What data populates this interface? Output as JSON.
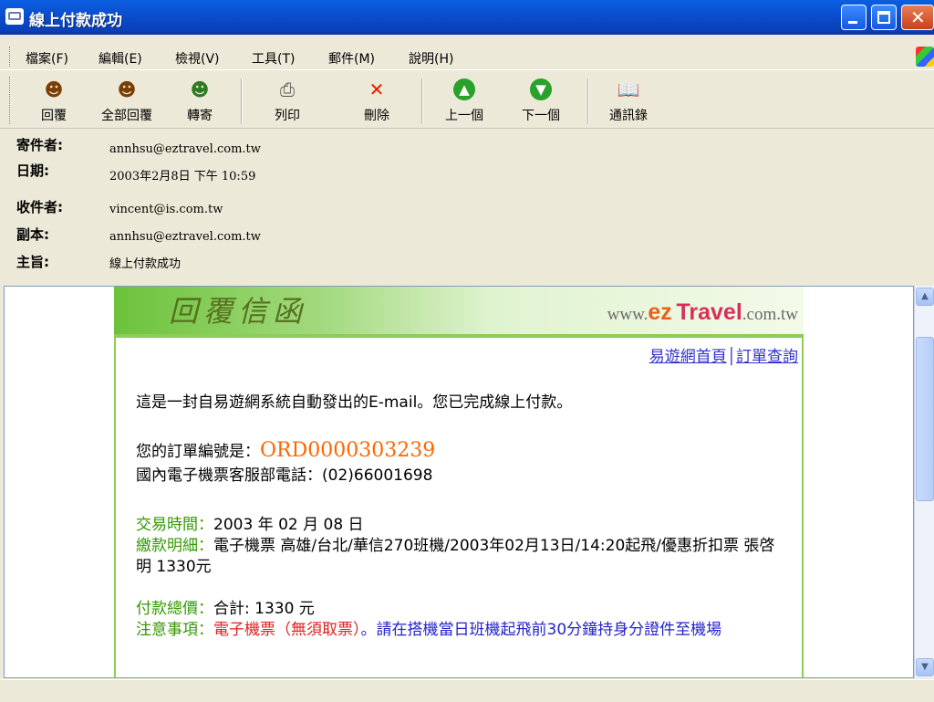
{
  "window": {
    "title": "線上付款成功"
  },
  "menu": [
    "檔案(F)",
    "編輯(E)",
    "檢視(V)",
    "工具(T)",
    "郵件(M)",
    "說明(H)"
  ],
  "toolbar": {
    "reply": "回覆",
    "reply_all": "全部回覆",
    "forward": "轉寄",
    "print": "列印",
    "delete": "刪除",
    "previous": "上一個",
    "next": "下一個",
    "address_book": "通訊錄"
  },
  "header": {
    "from_label": "寄件者:",
    "from": "annhsu@eztravel.com.tw",
    "date_label": "日期:",
    "date": "2003年2月8日 下午 10:59",
    "to_label": "收件者:",
    "to": "vincent@is.com.tw",
    "cc_label": "副本:",
    "cc": "annhsu@eztravel.com.tw",
    "subject_label": "主旨:",
    "subject": "線上付款成功"
  },
  "email": {
    "banner_title": "回覆信函",
    "site_prefix": "www.",
    "site_ez": "ez",
    "site_travel": "Travel",
    "site_suffix": ".com.tw",
    "link_home": "易遊網首頁",
    "link_sep": "│",
    "link_order": "訂單查詢",
    "intro": "這是一封自易遊網系統自動發出的E-mail。您已完成線上付款。",
    "order_label": "您的訂單編號是：",
    "order_no": "ORD0000303239",
    "phone": "國內電子機票客服部電話：(02)66001698",
    "txn_label": "交易時間：",
    "txn_value": "2003 年 02 月 08 日",
    "detail_label": "繳款明細：",
    "detail_value": "電子機票 高雄/台北/華信270班機/2003年02月13日/14:20起飛/優惠折扣票 張啓明 1330元",
    "total_label": "付款總價：",
    "total_value": "合計: 1330 元",
    "note_label": "注意事項：",
    "note_red": "電子機票（無須取票）",
    "note_blue": "。請在搭機當日班機起飛前30分鐘持身分證件至機場"
  }
}
